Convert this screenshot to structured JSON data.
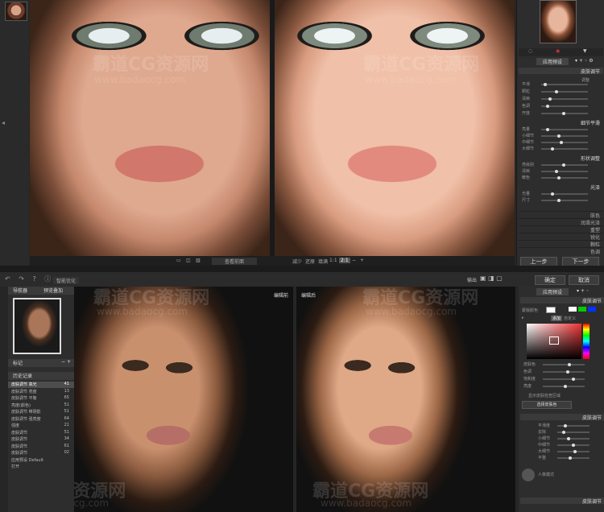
{
  "watermark": {
    "brand": "霸道CG资源网",
    "url": "www.badaocg.com"
  },
  "top": {
    "bottom_bar": {
      "view_label": "查看前面",
      "rotate": "减少",
      "compare": "还原",
      "fit": "填满",
      "ratio": "1:1",
      "zoom": "2:1",
      "minus": "−",
      "plus": "+"
    },
    "right_panel": {
      "tabs": [
        "◌",
        "◉",
        "▼"
      ],
      "preset_label": "应用预设",
      "section_skin": "皮肤调节",
      "section_skin_sub": "调整",
      "skin_sliders": [
        "平滑",
        "颗粒",
        "清晰",
        "色调",
        "开度"
      ],
      "section_detail": "细节平滑",
      "detail_sliders": [
        "亮量",
        "小细节",
        "中细节",
        "大细节"
      ],
      "section_color": "形状调整",
      "color_sliders": [
        "亮级别",
        "清晰",
        "暖色"
      ],
      "section_shine": "光泽",
      "shine_sliders": [
        "光量",
        "尺寸"
      ],
      "collapsed": [
        "肤色",
        "润滑光泽",
        "重塑",
        "锐化",
        "颗粒",
        "色调"
      ],
      "prev_button": "上一步",
      "next_button": "下一步"
    }
  },
  "bottom": {
    "toolbar": {
      "tools": "↶ ↷ ? ⓘ",
      "tab": "智能优化"
    },
    "left_panel": {
      "nav_title": "导航器",
      "nav_check": "预览叠加",
      "marker_title": "标记",
      "history_title": "历史记录",
      "history": [
        {
          "label": "皮肤调节 高光",
          "value": "41"
        },
        {
          "label": "皮肤调节 亮度",
          "value": "13"
        },
        {
          "label": "皮肤调节 平衡",
          "value": "65"
        },
        {
          "label": "亮度(颜色)",
          "value": "51"
        },
        {
          "label": "皮肤调节 带阴影",
          "value": "51"
        },
        {
          "label": "皮肤调节 强亮度",
          "value": "64"
        },
        {
          "label": "强度",
          "value": "21"
        },
        {
          "label": "皮肤调节",
          "value": "51"
        },
        {
          "label": "皮肤调节",
          "value": "34"
        },
        {
          "label": "皮肤调节",
          "value": "61"
        },
        {
          "label": "皮肤调节",
          "value": "02"
        },
        {
          "label": "应用预设 Default",
          "value": ""
        },
        {
          "label": "打开",
          "value": ""
        }
      ]
    },
    "photo_labels": {
      "before": "编辑前",
      "after": "编辑后"
    },
    "right_panel": {
      "output_label": "输出",
      "ok": "确定",
      "cancel": "取消",
      "preset_label": "应用预设",
      "section_skin": "皮肤调节",
      "skin_tone_label": "蒙版颜色",
      "swatch_modes": [
        "添加",
        "自定义"
      ],
      "picker_labels": [
        "皮肤色",
        "色调",
        "饱和度",
        "亮度"
      ],
      "checkbox": "显示皮肤检查区域",
      "reset": "选择皮肤色",
      "section_smooth": "皮肤调节",
      "smooth_sliders": [
        "平滑度",
        "去除",
        "小细节",
        "中细节",
        "大细节",
        "平整"
      ],
      "avatar_label": "人像模式",
      "section_last": "皮肤调节"
    }
  }
}
